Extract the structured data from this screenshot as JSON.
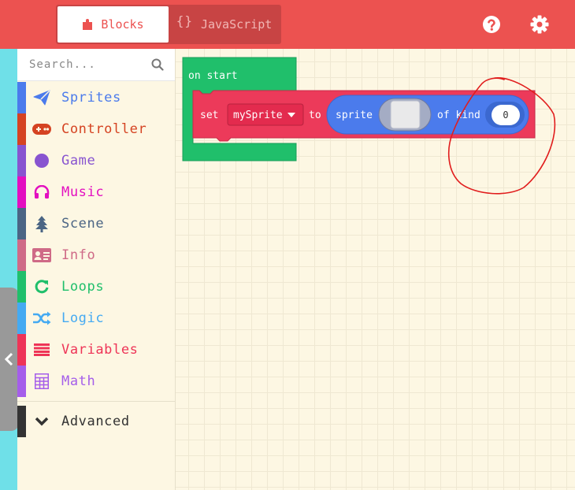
{
  "colors": {
    "accent": "#ec5250",
    "workspace": "#fdf7e3",
    "event_block": "#20bf6b",
    "sprite_block": "#ec3a5a",
    "sprite_reporter": "#4b7bec",
    "annotation": "#e11d1d"
  },
  "header": {
    "tabs": [
      {
        "label": "Blocks",
        "icon": "puzzle-icon",
        "active": true
      },
      {
        "label": "JavaScript",
        "icon": "braces-icon",
        "active": false
      }
    ],
    "icons": [
      "help-icon",
      "gear-icon"
    ]
  },
  "toolbox": {
    "search_placeholder": "Search...",
    "categories": [
      {
        "label": "Sprites",
        "icon": "paper-plane-icon",
        "color": "#4b6584"
      },
      {
        "label": "Controller",
        "icon": "gamepad-icon",
        "color": "#d54322"
      },
      {
        "label": "Game",
        "icon": "circle-icon",
        "color": "#8854d0"
      },
      {
        "label": "Music",
        "icon": "headphones-icon",
        "color": "#e30fc0"
      },
      {
        "label": "Scene",
        "icon": "tree-icon",
        "color": "#4b6584"
      },
      {
        "label": "Info",
        "icon": "id-card-icon",
        "color": "#cf6a87"
      },
      {
        "label": "Loops",
        "icon": "refresh-icon",
        "color": "#20bf6b"
      },
      {
        "label": "Logic",
        "icon": "shuffle-icon",
        "color": "#45aaf2"
      },
      {
        "label": "Variables",
        "icon": "list-icon",
        "color": "#ee3457"
      },
      {
        "label": "Math",
        "icon": "calculator-icon",
        "color": "#a55eea"
      }
    ],
    "advanced": {
      "label": "Advanced",
      "icon": "chevron-down-icon",
      "color": "#333333"
    }
  },
  "workspace": {
    "on_start_label": "on start",
    "set_label": "set",
    "variable_name": "mySprite",
    "to_label": "to",
    "sprite_label": "sprite",
    "of_kind_label": "of kind",
    "kind_value": "0"
  }
}
